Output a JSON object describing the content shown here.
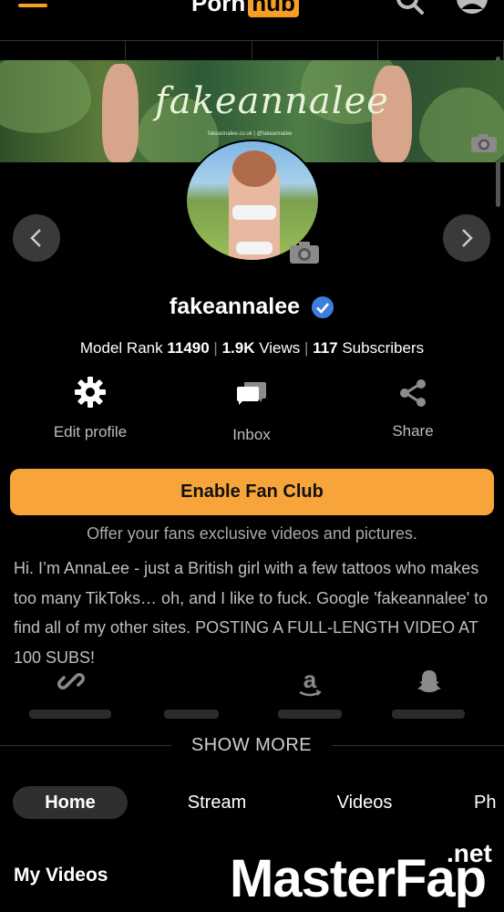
{
  "header": {
    "logo_part1": "Porn",
    "logo_part2": "hub"
  },
  "banner": {
    "script_name": "fakeannalee",
    "small_text": "fakeannalee.co.uk | @fakeannalee"
  },
  "profile": {
    "username": "fakeannalee",
    "stats": {
      "model_rank_label": "Model Rank",
      "model_rank": "11490",
      "views": "1.9K",
      "views_label": "Views",
      "subscribers": "117",
      "subscribers_label": "Subscribers",
      "separator": "|"
    }
  },
  "actions": {
    "edit_profile": "Edit profile",
    "inbox": "Inbox",
    "share": "Share"
  },
  "fan_club": {
    "button_label": "Enable Fan Club",
    "note": "Offer your fans exclusive videos and pictures."
  },
  "bio": "Hi. I’m AnnaLee - just a British girl with a few tattoos who makes too many TikToks… oh, and I like to fuck. Google 'fakeannalee' to find all of my other sites. POSTING A FULL-LENGTH VIDEO AT 100 SUBS!",
  "show_more": "SHOW MORE",
  "tabs": [
    {
      "label": "Home",
      "active": true
    },
    {
      "label": "Stream",
      "active": false
    },
    {
      "label": "Videos",
      "active": false
    },
    {
      "label": "Ph",
      "active": false
    }
  ],
  "section_title": "My Videos",
  "watermark": {
    "main": "MasterFap",
    "suffix": ".net"
  },
  "colors": {
    "accent": "#f7a43a",
    "background": "#000000",
    "verified": "#3d7fe0"
  }
}
